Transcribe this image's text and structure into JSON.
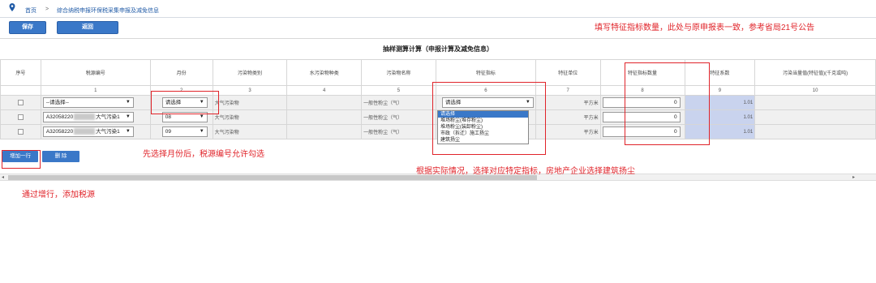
{
  "breadcrumb": {
    "home": "首页",
    "sep": ">",
    "current": "综合纳税申报环保税采集申报及减免信息"
  },
  "toolbar": {
    "save": "保存",
    "back": "返回"
  },
  "table_title": "抽样测算计算（申报计算及减免信息）",
  "columns": [
    "序号",
    "税源编号",
    "月份",
    "污染物类别",
    "水污染物种类",
    "污染物名称",
    "特征指标",
    "特征单位",
    "特征指标数量",
    "特征系数",
    "污染当量值(特征值)(千克或吨)"
  ],
  "column_numbers": [
    "",
    "1",
    "2",
    "3",
    "4",
    "5",
    "6",
    "7",
    "8",
    "9",
    "10"
  ],
  "rows": [
    {
      "source": "--请选择--",
      "month": "请选择",
      "category": "大气污染物",
      "name": "一般性粉尘（气）",
      "indicator": "请选择",
      "unit": "平方米",
      "qty": "0",
      "coef": "1.01"
    },
    {
      "source_prefix": "A32058220",
      "source_suffix": "大气污染1",
      "month": "08",
      "category": "大气污染物",
      "name": "一般性粉尘（气）",
      "unit": "平方米",
      "qty": "0",
      "coef": "1.01"
    },
    {
      "source_prefix": "A32058220",
      "source_suffix": "大气污染1",
      "month": "09",
      "category": "大气污染物",
      "name": "一般性粉尘（气）",
      "unit": "平方米",
      "qty": "0",
      "coef": "1.01"
    }
  ],
  "dropdown_options": [
    "请选择",
    "堆场粉尘(堆存粉尘)",
    "堆场粉尘(装卸粉尘)",
    "市政（拆迁）施工扬尘",
    "建筑扬尘"
  ],
  "buttons": {
    "add_row": "增加一行",
    "delete": "删 除"
  },
  "notes": {
    "top_right": "填写特征指标数量，此处与原申报表一致，参考省局21号公告",
    "month_tip": "先选择月份后，税源编号允许勾选",
    "indicator_tip": "根据实际情况，选择对应特定指标，房地产企业选择建筑扬尘",
    "add_tip": "通过增行，添加税源"
  },
  "colors": {
    "accent": "#3a78c8",
    "annotation": "#e0242a",
    "coef_bg": "#c9d3ee"
  }
}
